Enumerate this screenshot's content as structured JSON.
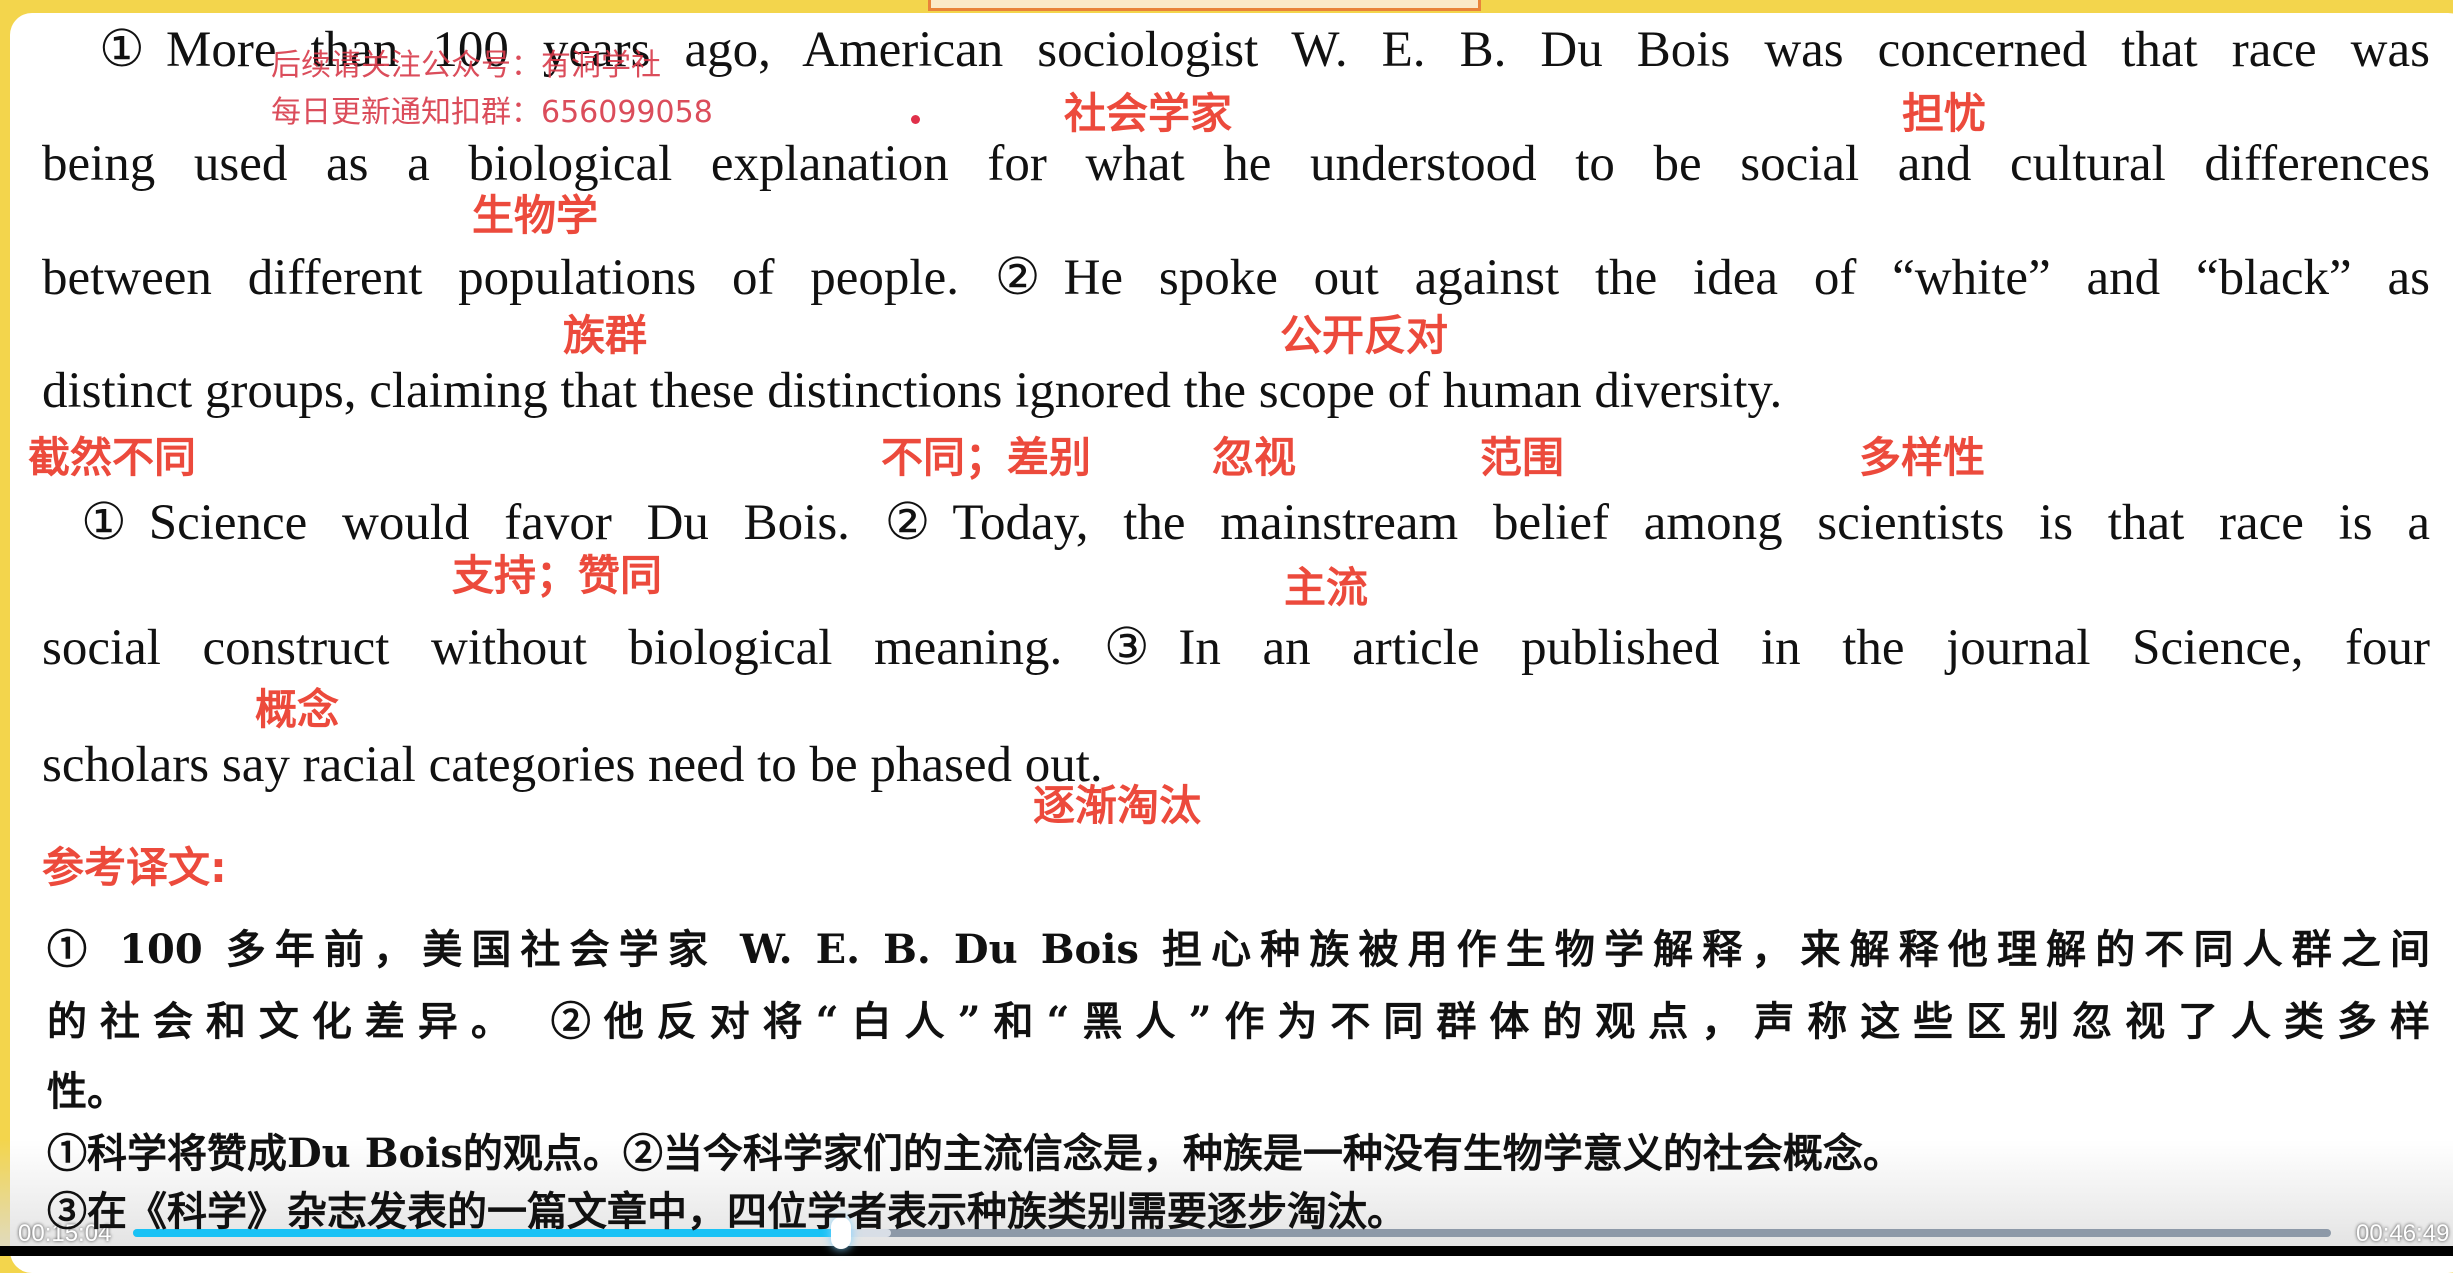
{
  "passage": {
    "para1": [
      "①More than 100 years ago, American sociologist W. E. B. Du Bois was concerned that race was",
      "being used as a biological explanation for what he understood to be social and cultural differences",
      "between different populations of people. ②He spoke out against the idea of “white” and “black” as",
      "distinct groups, claiming that these distinctions ignored the scope of human diversity."
    ],
    "para2": [
      "①Science would favor Du Bois. ②Today, the mainstream belief among scientists is that race is a",
      "social construct without biological meaning. ③In an article published in the journal Science, four",
      "scholars say racial categories need to be phased out."
    ]
  },
  "annotations": [
    "社会学家",
    "担忧",
    "生物学",
    "族群",
    "公开反对",
    "截然不同",
    "不同；差别",
    "忽视",
    "范围",
    "多样性",
    "支持；赞同",
    "主流",
    "概念",
    "逐渐淘汰"
  ],
  "watermark": [
    "后续请关注公众号：有洞学社",
    "每日更新通知扣群：656099058"
  ],
  "translation": {
    "heading": "参考译文:",
    "lines": [
      "① 100 多年前，美国社会学家 W. E. B. Du Bois 担心种族被用作生物学解释，来解释他理解的不同人群之间",
      "的社会和文化差异。 ②他反对将“白人”和“黑人”作为不同群体的观点，声称这些区别忽视了人类多样",
      "性。",
      "①科学将赞成Du  Bois的观点。②当今科学家们的主流信念是，种族是一种没有生物学意义的社会概念。",
      "③在《科学》杂志发表的一篇文章中，四位学者表示种族类别需要逐步淘汰。"
    ]
  },
  "player": {
    "current_time": "00:15:04",
    "duration": "00:46:49",
    "progress": 0.322,
    "buffered": 0.345
  },
  "colors": {
    "annotation": "#ec4a3c",
    "frame": "#f3d54c",
    "progress": "#19c2f5"
  }
}
